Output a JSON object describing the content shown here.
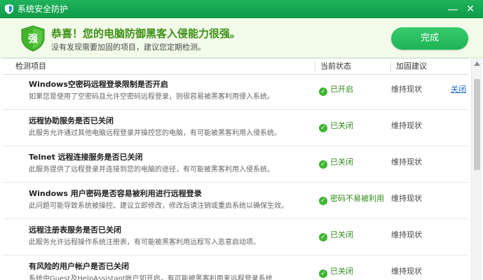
{
  "window": {
    "title": "系统安全防护",
    "minimize_label": "—",
    "close_label": "✕"
  },
  "banner": {
    "shield_char": "强",
    "headline": "恭喜！您的电脑防御黑客入侵能力很强。",
    "subline": "没有发现需要加固的项目，建议您定期检测。",
    "done_label": "完成"
  },
  "table": {
    "headers": {
      "item": "检测项目",
      "status": "当前状态",
      "suggestion": "加固建议"
    },
    "rows": [
      {
        "title": "Windows空密码远程登录限制是否开启",
        "desc": "如果您是使用了空密码且允许空密码远程登录，则很容易被黑客利用侵入系统。",
        "status": "已开启",
        "suggestion": "维持现状",
        "action": "关闭"
      },
      {
        "title": "远程协助服务是否已关闭",
        "desc": "此服务允许通过其他电脑远程登录并操控您的电脑，有可能被黑客利用入侵系统。",
        "status": "已关闭",
        "suggestion": "维持现状",
        "action": ""
      },
      {
        "title": "Telnet 远程连接服务是否已关闭",
        "desc": "此服务提供了远程登录并连接到您的电脑的途径，有可能被黑客利用入侵系统。",
        "status": "已关闭",
        "suggestion": "维持现状",
        "action": ""
      },
      {
        "title": "Windows 用户密码是否容易被利用进行远程登录",
        "desc": "此问题可能导致系统被操控。建议立即修改，修改后请注销或重启系统以确保生效。",
        "status": "密码不易被利用",
        "suggestion": "维持现状",
        "action": ""
      },
      {
        "title": "远程注册表服务是否已关闭",
        "desc": "此服务允许远程操作系统注册表，有可能被黑客利用远程写入恶意启动项。",
        "status": "已关闭",
        "suggestion": "维持现状",
        "action": ""
      },
      {
        "title": "有风险的用户帐户是否已关闭",
        "desc": "系统中Guest及HelpAssistant帐户如开启，有可能被黑客利用来远程登录系统",
        "status": "已关闭",
        "suggestion": "维持现状",
        "action": ""
      }
    ]
  },
  "colors": {
    "titlebar": "#109a47",
    "accent_green": "#2e8a18",
    "link_blue": "#1f66c8"
  }
}
